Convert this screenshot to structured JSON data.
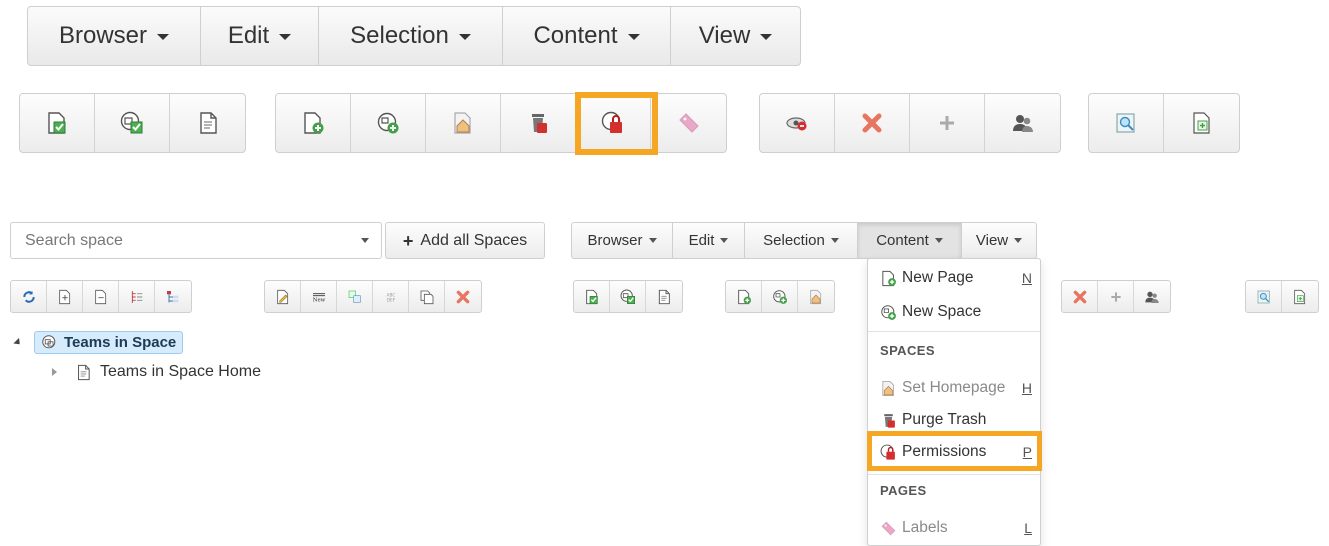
{
  "big_menubar": {
    "items": [
      {
        "label": "Browser"
      },
      {
        "label": "Edit"
      },
      {
        "label": "Selection"
      },
      {
        "label": "Content"
      },
      {
        "label": "View"
      }
    ]
  },
  "search": {
    "placeholder": "Search space"
  },
  "add_all_spaces": {
    "label": "Add all Spaces"
  },
  "small_menubar": {
    "items": [
      {
        "label": "Browser"
      },
      {
        "label": "Edit"
      },
      {
        "label": "Selection"
      },
      {
        "label": "Content"
      },
      {
        "label": "View"
      }
    ],
    "active": "Content"
  },
  "tree": {
    "root": "Teams in Space",
    "child": "Teams in Space Home"
  },
  "content_menu": {
    "new_page": {
      "label": "New Page",
      "key": "N"
    },
    "new_space": {
      "label": "New Space"
    },
    "spaces_header": "SPACES",
    "set_homepage": {
      "label": "Set Homepage",
      "key": "H"
    },
    "purge_trash": {
      "label": "Purge Trash"
    },
    "permissions": {
      "label": "Permissions",
      "key": "P"
    },
    "pages_header": "PAGES",
    "labels": {
      "label": "Labels",
      "key": "L"
    }
  },
  "colors": {
    "highlight": "#f5a623",
    "selected_node_bg": "#d6ebfb",
    "toolbar_border": "#cfcfcf"
  }
}
